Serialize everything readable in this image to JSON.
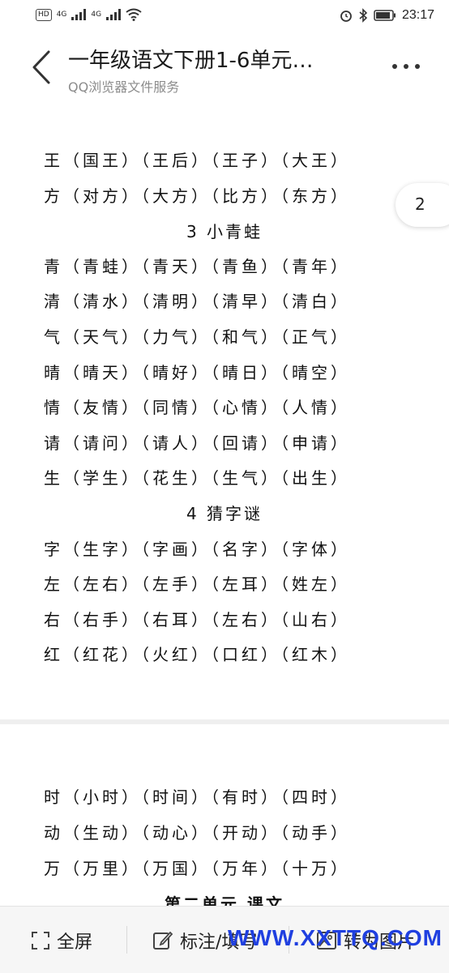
{
  "status_bar": {
    "hd_label": "HD",
    "sim1": "4G",
    "sim2": "4G",
    "time": "23:17"
  },
  "header": {
    "title": "一年级语文下册1-6单元…",
    "subtitle": "QQ浏览器文件服务"
  },
  "page1": {
    "lines_a": [
      "王（国王）（王后）（王子）（大王）",
      "方（对方）（大方）（比方）（东方）"
    ],
    "heading_3": "3  小青蛙",
    "lines_b": [
      "青（青蛙）（青天）（青鱼）（青年）",
      "清（清水）（清明）（清早）（清白）",
      "气（天气）（力气）（和气）（正气）",
      "晴（晴天）（晴好）（晴日）（晴空）",
      "情（友情）（同情）（心情）（人情）",
      "请（请问）（请人）（回请）（申请）",
      "生（学生）（花生）（生气）（出生）"
    ],
    "heading_4": "4  猜字谜",
    "lines_c": [
      "字（生字）（字画）（名字）（字体）",
      "左（左右）（左手）（左耳）（姓左）",
      "右（右手）（右耳）（左右）（山右）",
      "红（红花）（火红）（口红）（红木）"
    ]
  },
  "page2": {
    "lines": [
      "时（小时）（时间）（有时）（四时）",
      "动（生动）（动心）（开动）（动手）",
      "万（万里）（万国）（万年）（十万）"
    ],
    "partial_heading": "第二单元  课文"
  },
  "page_indicator": "2",
  "toolbar": {
    "fullscreen_label": "全屏",
    "annotate_label": "标注/填写",
    "convert_label": "转为图片"
  },
  "watermark": "WWW.XXTTQ.COM",
  "icons": {
    "back": "chevron-left-icon",
    "more": "more-dots-icon",
    "fullscreen": "fullscreen-icon",
    "annotate": "edit-icon",
    "convert": "image-icon"
  }
}
